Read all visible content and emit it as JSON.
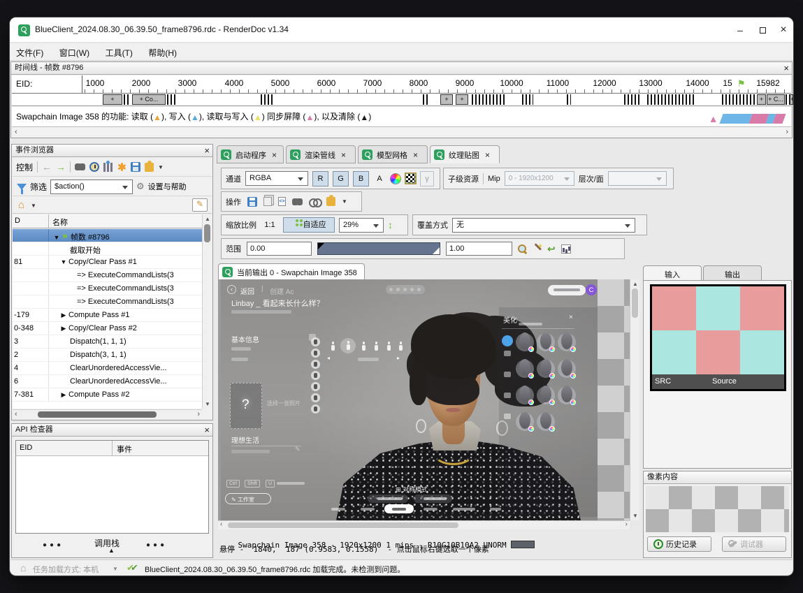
{
  "window": {
    "title": "BlueClient_2024.08.30_06.39.50_frame8796.rdc - RenderDoc v1.34",
    "minimize": "–",
    "close": "×"
  },
  "menu": {
    "items": [
      "文件(F)",
      "窗口(W)",
      "工具(T)",
      "帮助(H)"
    ]
  },
  "timeline": {
    "title": "时间线 - 帧数 #8796",
    "close": "×",
    "eid_label": "EID:",
    "ticks": [
      "1000",
      "2000",
      "3000",
      "4000",
      "5000",
      "6000",
      "7000",
      "8000",
      "9000",
      "10000",
      "11000",
      "12000",
      "13000",
      "14000",
      "15",
      "15982"
    ],
    "blocks": [
      "+",
      "+ Co...",
      "+",
      "+",
      "+",
      "+ C...",
      "+"
    ],
    "usage": {
      "p1": "Swapchain Image 358 的功能: 读取 (",
      "p2": "), 写入 (",
      "p3": "), 读取与写入 (",
      "p4": ") 同步屏障 (",
      "p5": "), 以及清除 (",
      "p6": ")"
    }
  },
  "event_browser": {
    "title": "事件浏览器",
    "close": "×",
    "control_label": "控制",
    "filter_label": "筛选",
    "filter_value": "$action()",
    "settings_label": "设置与帮助",
    "col1": "D",
    "col2": "名称",
    "rows": [
      {
        "eid": "",
        "name": "帧数 #8796"
      },
      {
        "eid": "",
        "name": "截取开始"
      },
      {
        "eid": "81",
        "name": "Copy/Clear Pass #1"
      },
      {
        "eid": "",
        "name": "=> ExecuteCommandLists(3"
      },
      {
        "eid": "",
        "name": "=> ExecuteCommandLists(3"
      },
      {
        "eid": "",
        "name": "=> ExecuteCommandLists(3"
      },
      {
        "eid": "-179",
        "name": "Compute Pass #1"
      },
      {
        "eid": "0-348",
        "name": "Copy/Clear Pass #2"
      },
      {
        "eid": "3",
        "name": "Dispatch(1, 1, 1)"
      },
      {
        "eid": "2",
        "name": "Dispatch(3, 1, 1)"
      },
      {
        "eid": "4",
        "name": "ClearUnorderedAccessVie..."
      },
      {
        "eid": "6",
        "name": "ClearUnorderedAccessVie..."
      },
      {
        "eid": "7-381",
        "name": "Compute Pass #2"
      }
    ]
  },
  "api_inspector": {
    "title": "API 检查器",
    "close": "×",
    "col_eid": "EID",
    "col_event": "事件",
    "callstack_label": "调用栈"
  },
  "texture_viewer": {
    "tabs": [
      {
        "label": "启动程序"
      },
      {
        "label": "渲染管线"
      },
      {
        "label": "模型网格"
      },
      {
        "label": "纹理贴图"
      }
    ],
    "channel_label": "通道",
    "channel_value": "RGBA",
    "btn_r": "R",
    "btn_g": "G",
    "btn_b": "B",
    "btn_a": "A",
    "btn_gamma": "γ",
    "subresource_label": "子级资源",
    "mip_label": "Mip",
    "mip_value": "0 - 1920x1200",
    "slice_label": "层次/面",
    "actions_label": "操作",
    "zoom_label": "缩放比例",
    "zoom_1to1": "1:1",
    "fit_label": "自适应",
    "zoom_value": "29%",
    "overlay_label": "覆盖方式",
    "overlay_value": "无",
    "range_label": "范围",
    "range_min": "0.00",
    "range_max": "1.00",
    "output_tab": "当前输出 0 - Swapchain Image 358",
    "status_line1": "Swapchain Image 358 - 1920x1200 1 mips - R10G10B10A2_UNORM",
    "status_line2": "悬停 -  1840,  187 (0.9583, 0.1558)  - 点击鼠标右键选取一个像素"
  },
  "io_panel": {
    "input_tab": "输入",
    "output_tab": "输出",
    "src_label": "SRC",
    "source_label": "Source"
  },
  "pixel_context": {
    "title": "像素内容",
    "history_label": "历史记录",
    "debug_label": "调试器"
  },
  "status_bar": {
    "mode_label": "任务加载方式: 本机",
    "message": "BlueClient_2024.08.30_06.39.50_frame8796.rdc 加载完成。未检测到问题。"
  },
  "game": {
    "back": "返回",
    "create": "创建 Ac",
    "title": "Linbay _ 看起来长什么样？",
    "basic_info": "基本信息",
    "ideal_life": "理想生活",
    "photo_q": "?",
    "photo_hint": "选择一张照片",
    "panel_title": "美化",
    "symmetry": "对称模式",
    "studio": "工作室",
    "keys": [
      "Ctrl",
      "Shift",
      "U"
    ]
  },
  "colors": {
    "brand_green": "#2ea05e",
    "selection_blue": "#5b8ac2",
    "usage_read": "#e8a33d",
    "usage_write": "#54a7e0",
    "usage_readwrite": "#e8df5a",
    "usage_barrier": "#d87ba8",
    "usage_clear": "#1a1a1a",
    "thumb_red": "#e89c9c",
    "thumb_cyan": "#abe6e1"
  }
}
